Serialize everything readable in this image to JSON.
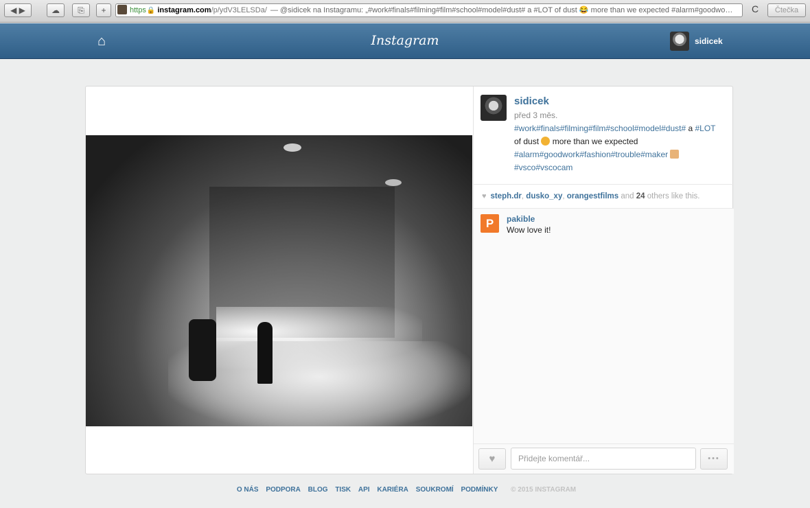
{
  "browser": {
    "back_label": "◀",
    "forward_label": "▶",
    "cloud_label": "☁",
    "share_label": "⎘",
    "add_label": "+",
    "url_scheme": "https",
    "url_domain": "instagram.com",
    "url_path": "/p/ydV3LELSDa/",
    "page_title": " — @sidicek na Instagramu: „#work#finals#filming#film#school#model#dust# a #LOT of dust 😂 more than we expected #alarm#goodwo…",
    "reload_label": "C",
    "reader_label": "Čtečka"
  },
  "header": {
    "home_icon": "home-icon",
    "logo_text": "Instagram",
    "username": "sidicek"
  },
  "post": {
    "username": "sidicek",
    "time": "před 3 měs.",
    "caption_tags1": "#work#finals#filming#film#school#model#dust#",
    "caption_text1": " a ",
    "caption_tag2": "#LOT",
    "caption_text2": " of dust ",
    "caption_text3": " more than we expected ",
    "caption_tags3": "#alarm#goodwork#fashion#trouble#maker",
    "caption_tags4": "#vsco#vscocam"
  },
  "likes": {
    "user1": "steph.dr",
    "user2": "dusko_xy",
    "user3": "orangestfilms",
    "and": " and ",
    "count": "24",
    "suffix": " others like this."
  },
  "comments": [
    {
      "user": "pakible",
      "text": "Wow love it!",
      "avatar_letter": "P"
    }
  ],
  "actions": {
    "like_icon": "heart-icon",
    "comment_placeholder": "Přidejte komentář...",
    "more_label": "•••"
  },
  "footer": {
    "links": [
      "O NÁS",
      "PODPORA",
      "BLOG",
      "TISK",
      "API",
      "KARIÉRA",
      "SOUKROMÍ",
      "PODMÍNKY"
    ],
    "copyright": "© 2015 INSTAGRAM"
  },
  "colors": {
    "header_blue": "#3f6d96",
    "link_blue": "#3f729b",
    "background": "#edeeee"
  }
}
